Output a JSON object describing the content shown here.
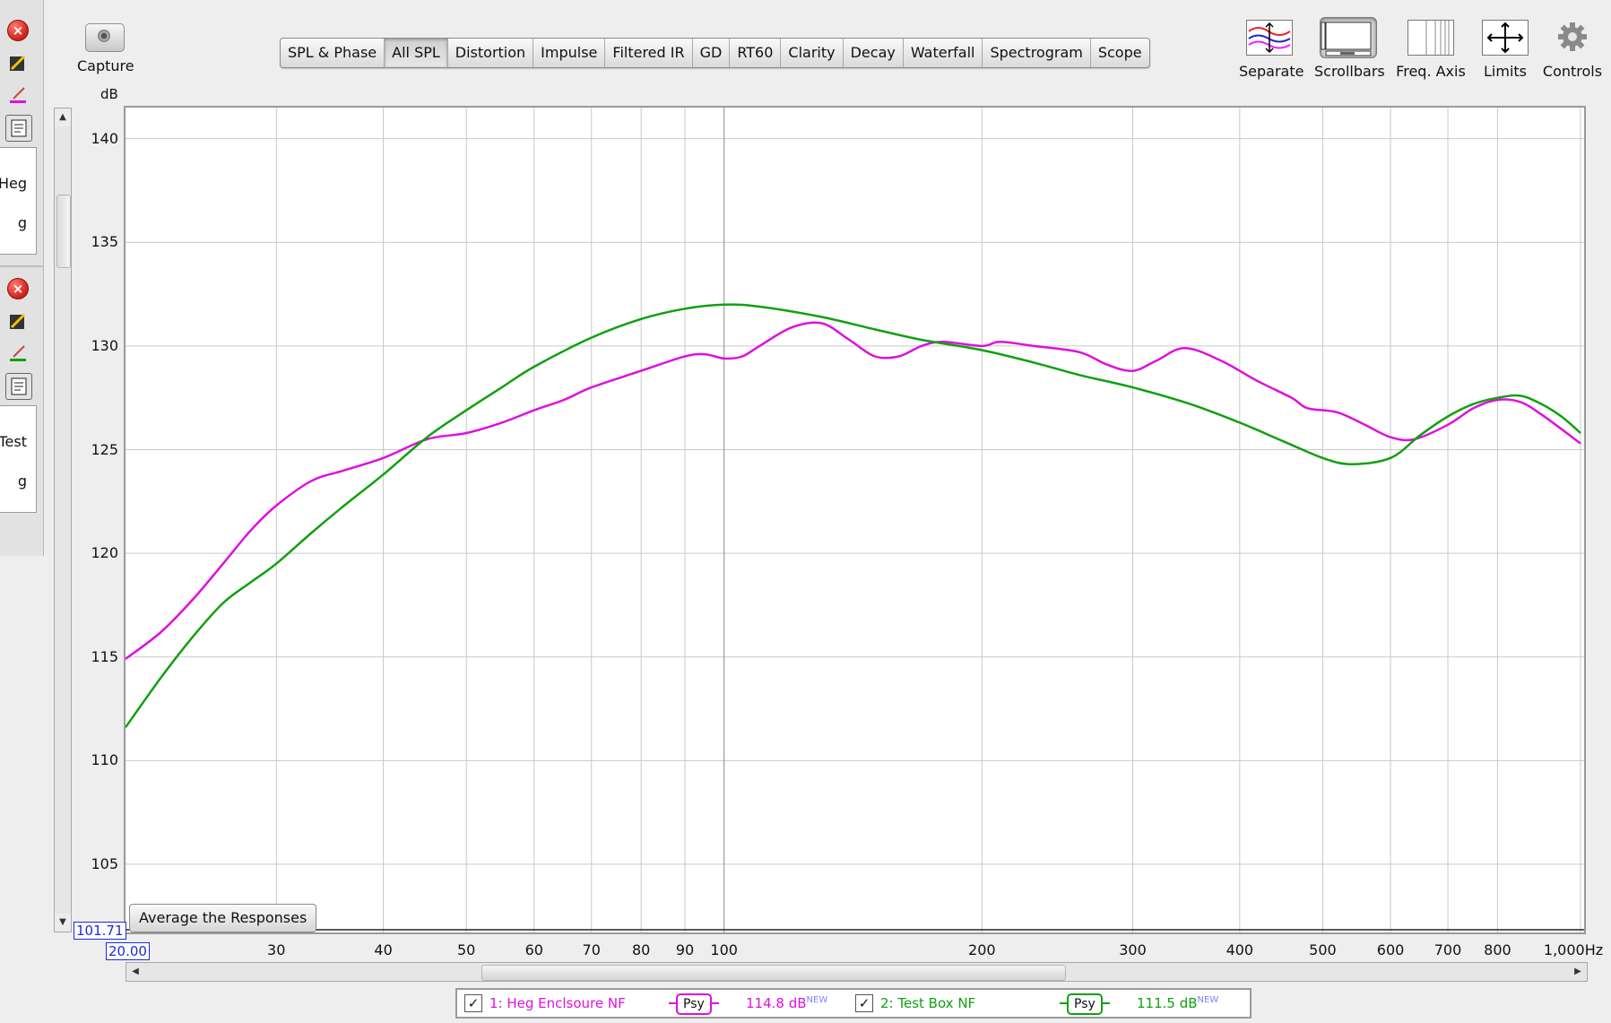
{
  "left_panel": {
    "items": [
      {
        "label_partial": "Heg",
        "sub_partial": "g"
      },
      {
        "label_partial": "Test",
        "sub_partial": "g"
      }
    ]
  },
  "toolbar": {
    "capture_label": "Capture",
    "tabs": [
      "SPL & Phase",
      "All SPL",
      "Distortion",
      "Impulse",
      "Filtered IR",
      "GD",
      "RT60",
      "Clarity",
      "Decay",
      "Waterfall",
      "Spectrogram",
      "Scope"
    ],
    "active_tab": "All SPL",
    "right_buttons": [
      {
        "label": "Separate",
        "icon": "separate-icon"
      },
      {
        "label": "Scrollbars",
        "icon": "scrollbars-icon",
        "pressed": true
      },
      {
        "label": "Freq. Axis",
        "icon": "freq-axis-icon"
      },
      {
        "label": "Limits",
        "icon": "limits-icon"
      },
      {
        "label": "Controls",
        "icon": "gear-icon"
      }
    ]
  },
  "plot": {
    "y_unit_label": "dB",
    "y_min_display": "101.71",
    "x_min_display": "20.00",
    "average_button": "Average the Responses"
  },
  "chart_data": {
    "type": "line",
    "title": "",
    "xlabel": "",
    "ylabel": "dB",
    "x_scale": "log",
    "xlim": [
      20,
      1000
    ],
    "ylim": [
      101.71,
      141.5
    ],
    "grid": true,
    "y_ticks": [
      105,
      110,
      115,
      120,
      125,
      130,
      135,
      140
    ],
    "x_ticks": [
      30,
      40,
      50,
      60,
      70,
      80,
      90,
      100,
      200,
      300,
      400,
      500,
      600,
      700,
      800,
      1000
    ],
    "x_tick_labels": [
      "30",
      "40",
      "50",
      "60",
      "70",
      "80",
      "90",
      "100",
      "200",
      "300",
      "400",
      "500",
      "600",
      "700",
      "800",
      "1,000Hz"
    ],
    "series": [
      {
        "name": "1: Heg Enclsoure NF",
        "color": "#dd11dd",
        "x": [
          20,
          22,
          24,
          26,
          28,
          30,
          33,
          36,
          40,
          45,
          50,
          55,
          60,
          65,
          70,
          80,
          90,
          95,
          100,
          105,
          110,
          120,
          130,
          140,
          150,
          160,
          170,
          180,
          200,
          210,
          230,
          260,
          280,
          300,
          320,
          345,
          380,
          420,
          460,
          480,
          520,
          560,
          600,
          640,
          700,
          750,
          800,
          850,
          900,
          1000
        ],
        "y": [
          114.9,
          116.2,
          117.8,
          119.5,
          121.1,
          122.3,
          123.5,
          124.0,
          124.6,
          125.5,
          125.8,
          126.3,
          126.9,
          127.4,
          128.0,
          128.8,
          129.5,
          129.6,
          129.4,
          129.5,
          130.0,
          130.9,
          131.1,
          130.3,
          129.5,
          129.5,
          130.0,
          130.2,
          130.0,
          130.2,
          130.0,
          129.7,
          129.1,
          128.8,
          129.3,
          129.9,
          129.3,
          128.3,
          127.5,
          127.0,
          126.8,
          126.2,
          125.6,
          125.5,
          126.2,
          127.0,
          127.4,
          127.3,
          126.7,
          125.3
        ]
      },
      {
        "name": "2: Test Box NF",
        "color": "#11a011",
        "x": [
          20,
          22,
          24,
          26,
          28,
          30,
          33,
          36,
          40,
          45,
          50,
          55,
          60,
          70,
          80,
          90,
          100,
          110,
          130,
          150,
          170,
          200,
          230,
          260,
          300,
          350,
          400,
          450,
          500,
          540,
          600,
          650,
          700,
          750,
          800,
          850,
          900,
          950,
          1000
        ],
        "y": [
          111.6,
          114.0,
          116.0,
          117.6,
          118.6,
          119.5,
          121.0,
          122.3,
          123.8,
          125.6,
          126.9,
          128.0,
          129.0,
          130.4,
          131.3,
          131.8,
          132.0,
          131.9,
          131.4,
          130.8,
          130.3,
          129.8,
          129.2,
          128.6,
          128.0,
          127.2,
          126.3,
          125.4,
          124.6,
          124.3,
          124.6,
          125.7,
          126.6,
          127.2,
          127.5,
          127.6,
          127.2,
          126.6,
          125.8
        ]
      }
    ]
  },
  "legend": {
    "items": [
      {
        "label": "1: Heg Enclsoure NF",
        "psy": "Psy",
        "value": "114.8 dB",
        "tag": "NEW",
        "color": "#dd11dd"
      },
      {
        "label": "2: Test Box NF",
        "psy": "Psy",
        "value": "111.5 dB",
        "tag": "NEW",
        "color": "#11a011"
      }
    ]
  }
}
